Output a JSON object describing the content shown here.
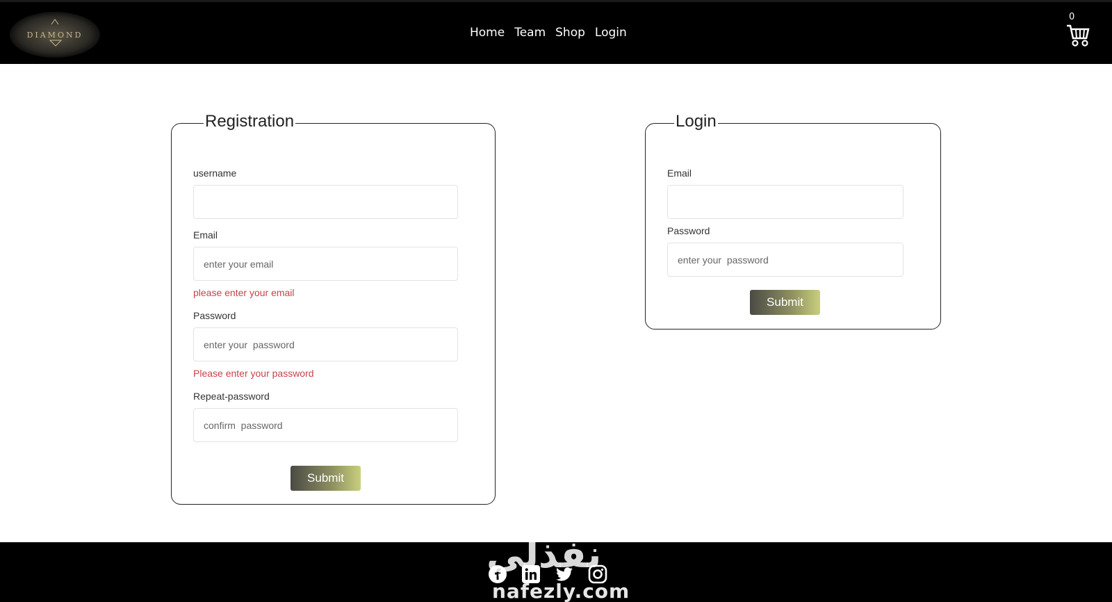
{
  "header": {
    "logo_text": "DIAMOND",
    "nav": [
      {
        "label": "Home"
      },
      {
        "label": "Team"
      },
      {
        "label": "Shop"
      },
      {
        "label": "Login"
      }
    ],
    "cart_count": "0"
  },
  "registration": {
    "title": "Registration",
    "username_label": "username",
    "username_value": "",
    "email_label": "Email",
    "email_placeholder": "enter your email",
    "email_error": "please enter your email",
    "password_label": "Password",
    "password_placeholder": "enter your  password",
    "password_error": "Please enter your password",
    "repeat_label": "Repeat-password",
    "repeat_placeholder": "confirm  password",
    "submit_label": "Submit"
  },
  "login": {
    "title": "Login",
    "email_label": "Email",
    "email_value": "",
    "password_label": "Password",
    "password_placeholder": "enter your  password",
    "submit_label": "Submit"
  },
  "footer": {
    "social": [
      "facebook-icon",
      "linkedin-icon",
      "twitter-icon",
      "instagram-icon"
    ],
    "watermark_ar": "نفذلي",
    "watermark_en": "nafezly.com"
  },
  "colors": {
    "header_bg": "#000000",
    "error": "#c8414b",
    "button_gradient_start": "#4a4a44",
    "button_gradient_end": "#c9cf7e"
  }
}
